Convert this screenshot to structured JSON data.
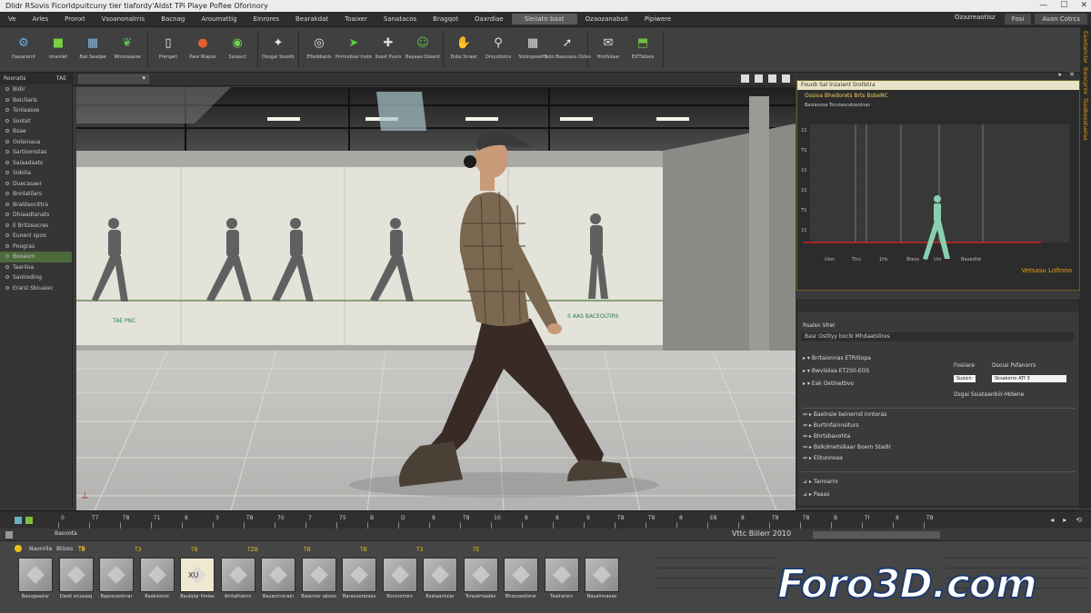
{
  "titlebar": {
    "title": "Dlidr RSovis Ficorldpuitcuny tier tiafordy'Aldst TPi Playe Poflee Oforinory"
  },
  "menubar": {
    "items": [
      "Ve",
      "Arles",
      "Pronxt",
      "Vsoanonalrris",
      "Bacnag",
      "Aroumattig",
      "Einrores",
      "Bearakdat",
      "Toaixer",
      "Sanatacos",
      "Bragqot",
      "Oaxrdiae"
    ],
    "active": "Sleiiatn baxt",
    "after": [
      "Ozaozanabsit",
      "Pipiwere"
    ],
    "right": [
      "Ozazreaotisz",
      "Fosi",
      "Avan Cotrcs"
    ]
  },
  "toolbar": {
    "groups": [
      [
        {
          "label": "Oaxacernt",
          "icon": "gear-icon",
          "color": "#6ab0e8"
        },
        {
          "label": "Imasilet",
          "icon": "cube-icon",
          "color": "#7ad040"
        },
        {
          "label": "Baii Seaiipe",
          "icon": "grid-icon",
          "color": "#88b8e0"
        },
        {
          "label": "Wrrosiaaioe",
          "icon": "leaf-icon",
          "color": "#58c050"
        }
      ],
      [
        {
          "label": "Prerqart",
          "icon": "page-icon",
          "color": "#f0f0f0"
        },
        {
          "label": "Pare Rtapss",
          "icon": "sphere-icon",
          "color": "#e06030"
        },
        {
          "label": "Ssoasct",
          "icon": "eye-icon",
          "color": "#70d050"
        }
      ],
      [
        {
          "label": "Oosgai Siooitk",
          "icon": "joint-icon",
          "color": "#e8e8e8"
        }
      ],
      [
        {
          "label": "Efleddiaois",
          "icon": "target-icon",
          "color": "#e0e0e0"
        },
        {
          "label": "Pnmndlsai inote",
          "icon": "arrow-icon",
          "color": "#58d040"
        },
        {
          "label": "Ilsaxt Puvrs",
          "icon": "pin-icon",
          "color": "#d8d8d8"
        },
        {
          "label": "Bayaae Ozaxnt",
          "icon": "figure-icon",
          "color": "#60c040"
        }
      ],
      [
        {
          "label": "Dsbs Srraat",
          "icon": "hand-icon",
          "color": "#e0e0e0"
        },
        {
          "label": "Orscotiotcs",
          "icon": "link-icon",
          "color": "#e0e0e0"
        },
        {
          "label": "Stoinqesetts",
          "icon": "grid-icon",
          "color": "#e0e0e0"
        },
        {
          "label": "Tsdo Bseusaos Ozlxs",
          "icon": "cursor-icon",
          "color": "#e0e0e0"
        }
      ],
      [
        {
          "label": "Hinifsiiaar",
          "icon": "mail-icon",
          "color": "#e0e0e0"
        },
        {
          "label": "EXTSdoos",
          "icon": "export-icon",
          "color": "#70c040"
        }
      ]
    ]
  },
  "leftpanel": {
    "title": "Rooratis",
    "badge": "TAE",
    "items": [
      "Bidir",
      "Beicliarls",
      "Tonlaasxe",
      "Sootet",
      "Bsae",
      "Oolainaua",
      "Sartioonstas",
      "Saiaadaats",
      "Sidolia",
      "Duecasaer",
      "Bnnlatilars",
      "Braldaocittra",
      "Dhiaadtanats",
      "E Britzeacres",
      "Eunenl spoo",
      "Pnogras"
    ],
    "selected": "Boxaurn",
    "after": [
      "Taariloa",
      "Saolreding",
      "Erarsl Sbiuaiec"
    ]
  },
  "viewport": {
    "label_left": "TAE  PNC",
    "label_right": "S AAS BACEOLTIRS"
  },
  "graphpanel": {
    "header": "Fouob Sal lnzaiant Srollstra",
    "title": "Ossioa Bhedorets Brts BsbeNC",
    "subtitle": "Basiaocoa Tocsiaocatosoinas",
    "yticks": [
      "1S",
      "TS",
      "1S",
      "1S",
      "TS",
      "1S"
    ],
    "xticks": [
      "Ulos",
      "Tlcs",
      "1Hs",
      "Bteos",
      "Urs",
      "Baoadhb"
    ],
    "footer": "Vetsasu Loltnno",
    "accent": "#e8a020",
    "line_color": "#d02020"
  },
  "propspanel": {
    "header": "Rsalsn Vlrel",
    "subheader": "Basr Ostllyy boclk Mhdaatsllres",
    "rows": [
      "Brrtaionnas ETRISopa",
      "Bwvlsiiaa ET2S0-EOS",
      "Eak Oetinetbvo"
    ],
    "field1_label": "Fosiiare",
    "field1_value": "Suoicn",
    "field2_label": "Dsoiai Psfanorrs",
    "field2_value": "Sksakorro  ATf 3",
    "note": "Dsgai Ssiataanbiir-Mdwne",
    "list": [
      "Baelnsie beinernd inntoras",
      "Burtinfainnsiturs",
      "Bhrtsbavohta",
      "Bsikdmetsikaar Boern Stadir",
      "Elitunnoaa"
    ],
    "bottom": [
      "Tarroarro",
      "Paaas"
    ]
  },
  "rightstrip": {
    "labels": [
      "Eaostariclar",
      "Baiocyrinr",
      "Tsaobaoatuelaa"
    ]
  },
  "timeline": {
    "ticks": [
      "0",
      "T7",
      "T8",
      "T1",
      "8",
      "3",
      "T8",
      "70",
      "7",
      "75",
      "B",
      "D",
      "8",
      "T8",
      "10",
      "8",
      "8",
      "9",
      "T8",
      "T8",
      "8",
      "E8",
      "8",
      "T8",
      "T8",
      "B",
      "TI",
      "8",
      "T8"
    ]
  },
  "assetbar": {
    "left": "Baovota",
    "center": "Vttc Biilerr 2010"
  },
  "assets": {
    "title": "Naonrila",
    "title2": "Btizes",
    "badge": "TB",
    "numbers": [
      "T8",
      "T3",
      "TB",
      "TZB",
      "TB",
      "TB",
      "T3",
      "TE"
    ],
    "items": [
      "Baxsgaaoisr",
      "Daoit scuasaq",
      "Bapsscesinrar",
      "Baaksonss",
      "Baulqlqr hmias",
      "Alntalttanrs",
      "Bauarcnsirain",
      "Baiansor aboos",
      "Baraooorerass",
      "Bonrsornirs",
      "Bsataantsiar",
      "Tsrautmaaibs",
      "Bhocsaoitsrar",
      "Taalrarars",
      "Baualnnaaxe"
    ],
    "highlighted_label": "XU"
  },
  "watermark": "Foro3D.com"
}
